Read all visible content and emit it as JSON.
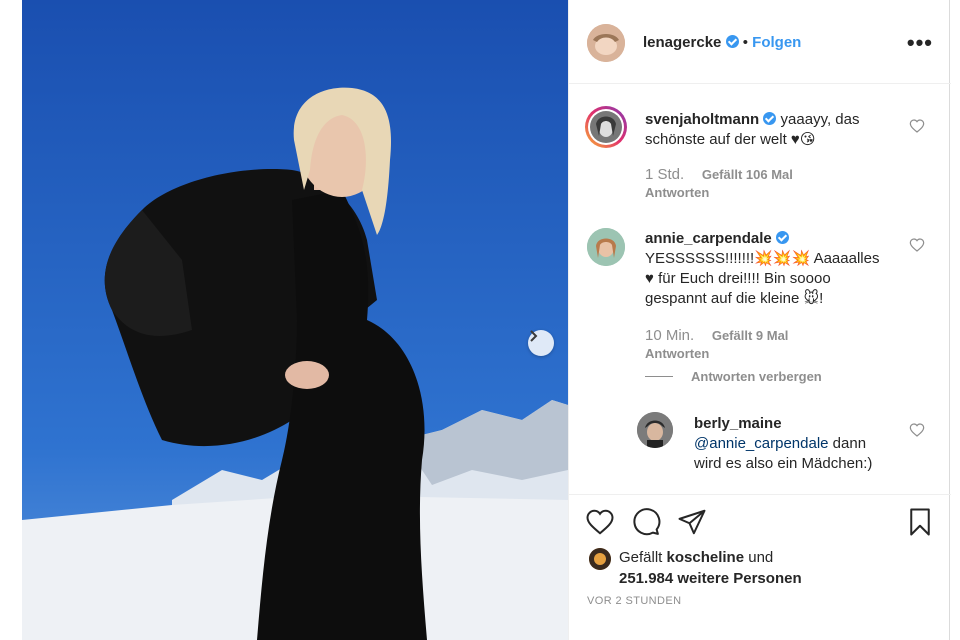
{
  "post": {
    "author": "lenagercke",
    "follow_label": "Folgen",
    "more_label": "•••"
  },
  "comments": [
    {
      "username": "svenjaholtmann",
      "text": "yaaayy, das schönste auf der welt ♥😘",
      "time": "1 Std.",
      "likes": "Gefällt 106 Mal",
      "reply": "Antworten"
    },
    {
      "username": "annie_carpendale",
      "text_line1": "YESSSSSS!!!!!!!💥💥💥 Aaaaalles",
      "text_line2": "♥ für Euch drei!!!! Bin soooo",
      "text_line3": "gespannt auf die kleine 🐭!",
      "time": "10 Min.",
      "likes": "Gefällt 9 Mal",
      "reply": "Antworten"
    }
  ],
  "hide_replies": "Antworten verbergen",
  "reply": {
    "username": "berly_maine",
    "mention": "@annie_carpendale",
    "text_rest": "dann",
    "text_line2": "wird es also ein Mädchen:)"
  },
  "likes": {
    "prefix": "Gefällt",
    "first_user": "koscheline",
    "and": "und",
    "count_line": "251.984 weitere Personen"
  },
  "timestamp": "VOR 2 STUNDEN",
  "colors": {
    "sky": "#1f5ab8",
    "link_blue": "#3897f0",
    "muted": "#8e8e8e",
    "text": "#262626"
  },
  "icons": [
    "heart-icon",
    "comment-icon",
    "share-icon",
    "bookmark-icon",
    "more-icon",
    "chevron-right-icon",
    "verified-icon"
  ]
}
